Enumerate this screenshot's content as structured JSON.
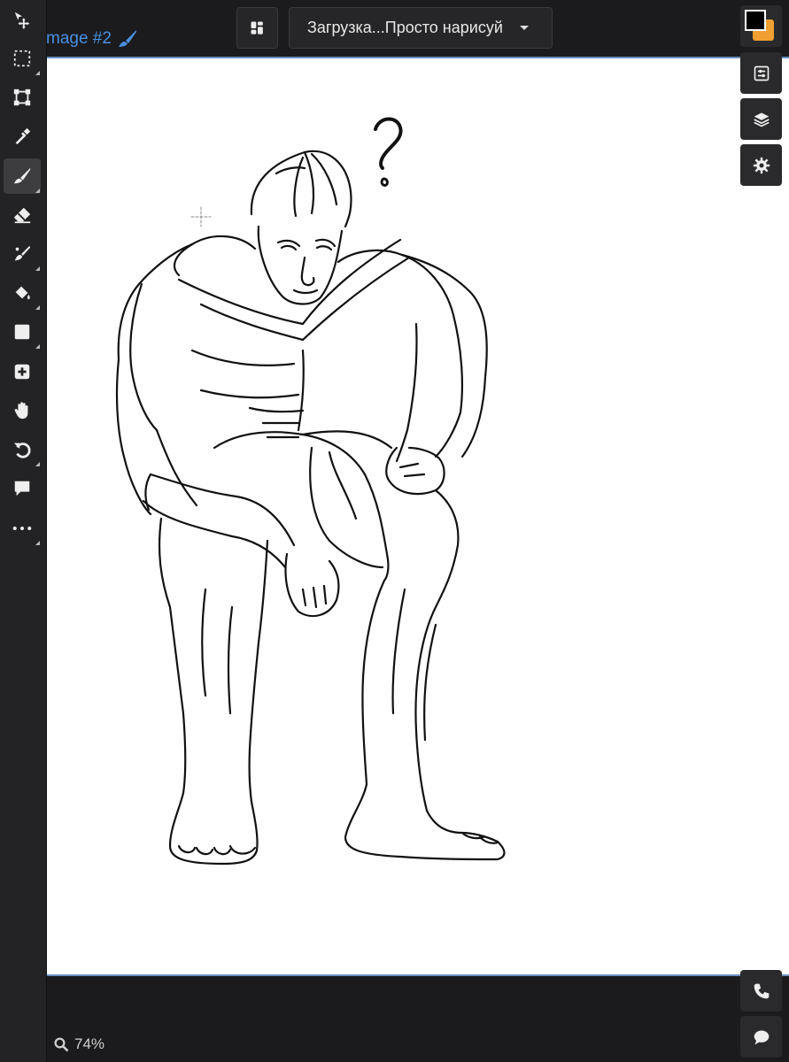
{
  "document": {
    "title": "mage #2"
  },
  "header": {
    "project_label": "Загрузка...Просто нарисуй"
  },
  "toolbar": {
    "tools": [
      {
        "name": "move",
        "icon": "move-icon"
      },
      {
        "name": "select",
        "icon": "selection-icon"
      },
      {
        "name": "transform",
        "icon": "transform-icon"
      },
      {
        "name": "eyedropper",
        "icon": "eyedropper-icon"
      },
      {
        "name": "brush",
        "icon": "brush-icon",
        "active": true
      },
      {
        "name": "eraser",
        "icon": "eraser-icon"
      },
      {
        "name": "smudge",
        "icon": "smudge-icon"
      },
      {
        "name": "fill",
        "icon": "paint-bucket-icon"
      },
      {
        "name": "shape",
        "icon": "square-icon"
      },
      {
        "name": "add",
        "icon": "plus-icon"
      },
      {
        "name": "hand",
        "icon": "hand-icon"
      },
      {
        "name": "undo",
        "icon": "undo-icon"
      },
      {
        "name": "comment",
        "icon": "speech-bubble-icon"
      },
      {
        "name": "more",
        "icon": "more-icon"
      }
    ]
  },
  "colors": {
    "primary": "#000000",
    "secondary": "#f0a030",
    "accent": "#4a8fe0"
  },
  "status": {
    "zoom": "74%"
  }
}
